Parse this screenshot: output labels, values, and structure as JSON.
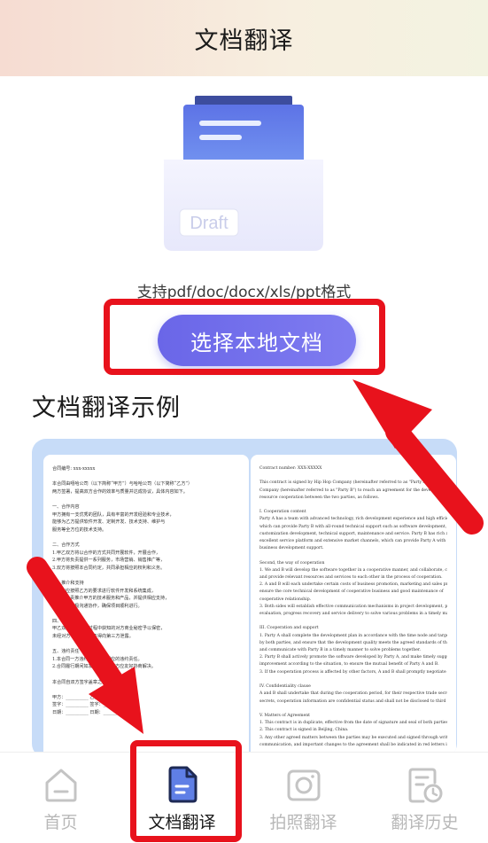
{
  "header": {
    "title": "文档翻译"
  },
  "upload": {
    "illustration_label": "Draft",
    "formats_text": "支持pdf/doc/docx/xls/ppt格式",
    "select_button": "选择本地文档"
  },
  "example": {
    "title": "文档翻译示例",
    "left_doc_lines": [
      "合同编号: xxx-xxxxx",
      "",
      "本合同由嘻哈公司（以下简称“甲方”）与哈哈公司（以下简称“乙方”）",
      "两方签署，提高双方合作的效率与质量并达成协议，具体内容如下。",
      "",
      "一、合作内容",
      "甲方拥有一支优秀的团队，具有丰富的开发经验和专业技术，",
      "能够为乙方提供软件开发、定制开发、技术支持、维护与",
      "服务等全方位的技术支持。",
      "",
      "二、合作方式",
      "1.甲乙双方将以合作的方式共同开展软件，开展合作，",
      "2.甲方将负责提供一系列服务，市场营销、销售推广等，",
      "3.双方将按照本合同约定，共同承担相应的权利和义务。",
      "",
      "三、推介和支持",
      "1.甲方应按照乙方的要求进行软件开发和系统集成，",
      "2.乙方负责推介甲方的技术服务和产品，并提供相应支持，",
      "3.双方应积极沟通协作，确保项目顺利进行。",
      "",
      "四、保密条款",
      "甲乙双方应对合作过程中获知的对方商业秘密予以保密，",
      "未经对方书面同意，不得向第三方泄露。",
      "",
      "五、违约责任",
      "1.本合同一方违约，应承担相应的违约责任。",
      "2.合同履行期间如发生争议，双方应友好协商解决。",
      "",
      "本合同自双方签字盖章之日起生效。",
      "",
      "甲方：__________      乙方：__________",
      "签字：__________      签字：__________",
      "日期：__________      日期：__________"
    ],
    "right_doc_lines": [
      "Contract number: XXX-XXXXX",
      "",
      "This contract is signed by Hip Hop Company (hereinafter referred to as \"Party A\") and Ha Ha",
      "Company (hereinafter referred to as \"Party B\") to reach an agreement for the development and",
      "resource cooperation between the two parties, as follows.",
      "",
      "I. Cooperation content",
      "Party A has a team with advanced technology, rich development experience and high efficiency,",
      "which can provide Party B with all-round technical support such as software development,",
      "customization development, technical support, maintenance and service. Party B has rich and",
      "excellent service platform and extensive market channels, which can provide Party A with the",
      "business development support.",
      "",
      "Second, the way of cooperation",
      "1. We and B will develop the software together in a cooperative manner, and collaborate, coordinate",
      "and provide relevant resources and services to each other in the process of cooperation.",
      "2. A and B will each undertake certain costs of business promotion, marketing and sales promotion to",
      "ensure the core technical development of cooperative business and good maintenance of",
      "cooperative relationship.",
      "3. Both sides will establish effective communication mechanisms in project development, process",
      "evaluation, progress recovery and service delivery to solve various problems in a timely manner.",
      "",
      "III. Cooperation and support",
      "1. Party A shall complete the development plan in accordance with the time node and targets agreed",
      "by both parties, and ensure that the development quality meets the agreed standards of the contract,",
      "and communicate with Party B in a timely manner to solve problems together.",
      "2. Party B shall actively promote the software developed by Party A, and make timely suggestions for",
      "improvement according to the situation, to ensure the mutual benefit of Party A and B.",
      "3. If the cooperation process is affected by other factors, A and B shall promptly negotiate a solution.",
      "",
      "IV. Confidentiality clause",
      "A and B shall undertake that during the cooperation period, for their respective trade secrets, technical",
      "secrets, cooperation information are confidential status and shall not be disclosed to third parties.",
      "",
      "V. Matters of Agreement",
      "1. This contract is in duplicate, effective from the date of signature and seal of both parties.",
      "2. This contract is signed in Beijing, China.",
      "3. Any other agreed matters between the parties may be executed and signed through written",
      "communication, and important changes to the agreement shall be indicated in red letters in the title.",
      "",
      "This contract shall be effective from the date of signing and",
      "",
      "shall terminate on the date of completion of the project. Party"
    ]
  },
  "tabs": [
    {
      "label": "首页",
      "icon": "home-icon",
      "active": false
    },
    {
      "label": "文档翻译",
      "icon": "document-icon",
      "active": true
    },
    {
      "label": "拍照翻译",
      "icon": "camera-icon",
      "active": false
    },
    {
      "label": "翻译历史",
      "icon": "history-icon",
      "active": false
    }
  ],
  "colors": {
    "accent": "#6a66e8",
    "highlight_red": "#e8121c",
    "example_bg": "#c7dcf8"
  }
}
